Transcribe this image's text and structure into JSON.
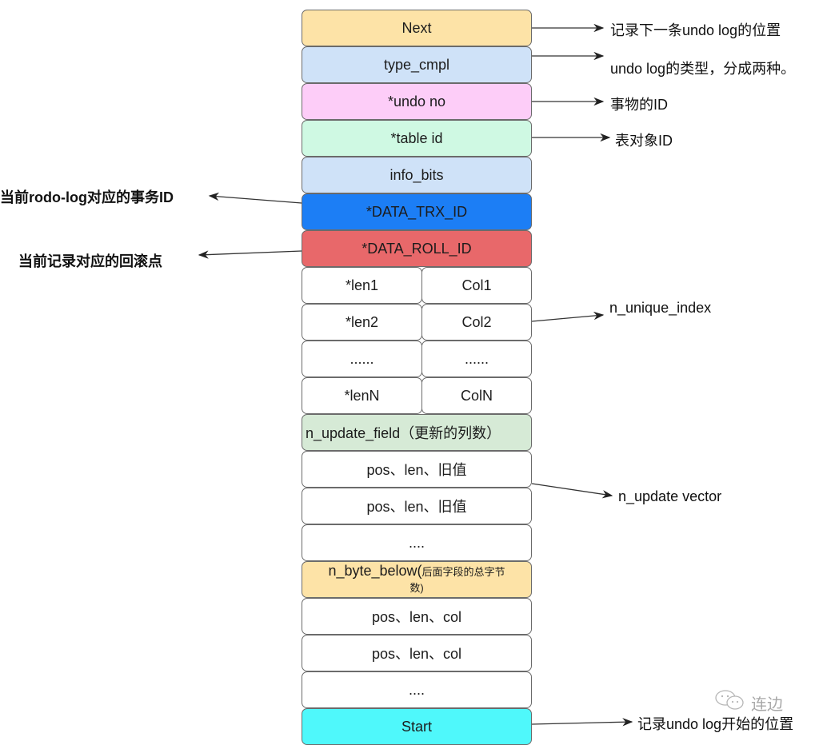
{
  "diagram": {
    "rows": [
      {
        "label": "Next",
        "color": "#fde3a7"
      },
      {
        "label": "type_cmpl",
        "color": "#cfe2f8"
      },
      {
        "label": "*undo no",
        "color": "#fdcdf8"
      },
      {
        "label": "*table id",
        "color": "#cff9e3"
      },
      {
        "label": "info_bits",
        "color": "#cfe2f8"
      },
      {
        "label": "*DATA_TRX_ID",
        "color": "#1c7ef5"
      },
      {
        "label": "*DATA_ROLL_ID",
        "color": "#e8686a"
      },
      {
        "left": "*len1",
        "right": "Col1"
      },
      {
        "left": "*len2",
        "right": "Col2"
      },
      {
        "left": "......",
        "right": "......"
      },
      {
        "left": "*lenN",
        "right": "ColN"
      },
      {
        "label": "n_update_field（更新的列数）",
        "color": "#d6ead6"
      },
      {
        "label": "pos、len、旧值",
        "color": "#ffffff"
      },
      {
        "label": "pos、len、旧值",
        "color": "#ffffff"
      },
      {
        "label": "....",
        "color": "#ffffff"
      },
      {
        "label": "n_byte_below(",
        "label_small": "后面字段的总字节",
        "label_line2": "数)",
        "color": "#fde3a7"
      },
      {
        "label": "pos、len、col",
        "color": "#ffffff"
      },
      {
        "label": "pos、len、col",
        "color": "#ffffff"
      },
      {
        "label": "....",
        "color": "#ffffff"
      },
      {
        "label": "Start",
        "color": "#4ff8fb"
      }
    ],
    "annotations": {
      "next": "记录下一条undo log的位置",
      "type_cmpl": "undo log的类型，分成两种。",
      "undo_no": "事物的ID",
      "table_id": "表对象ID",
      "trx_id": "当前rodo-log对应的事务ID",
      "roll_id": "当前记录对应的回滚点",
      "unique_index": "n_unique_index",
      "update_vector": "n_update vector",
      "start": "记录undo log开始的位置"
    },
    "watermark": {
      "icon": "wechat-icon",
      "text": "连边"
    }
  }
}
